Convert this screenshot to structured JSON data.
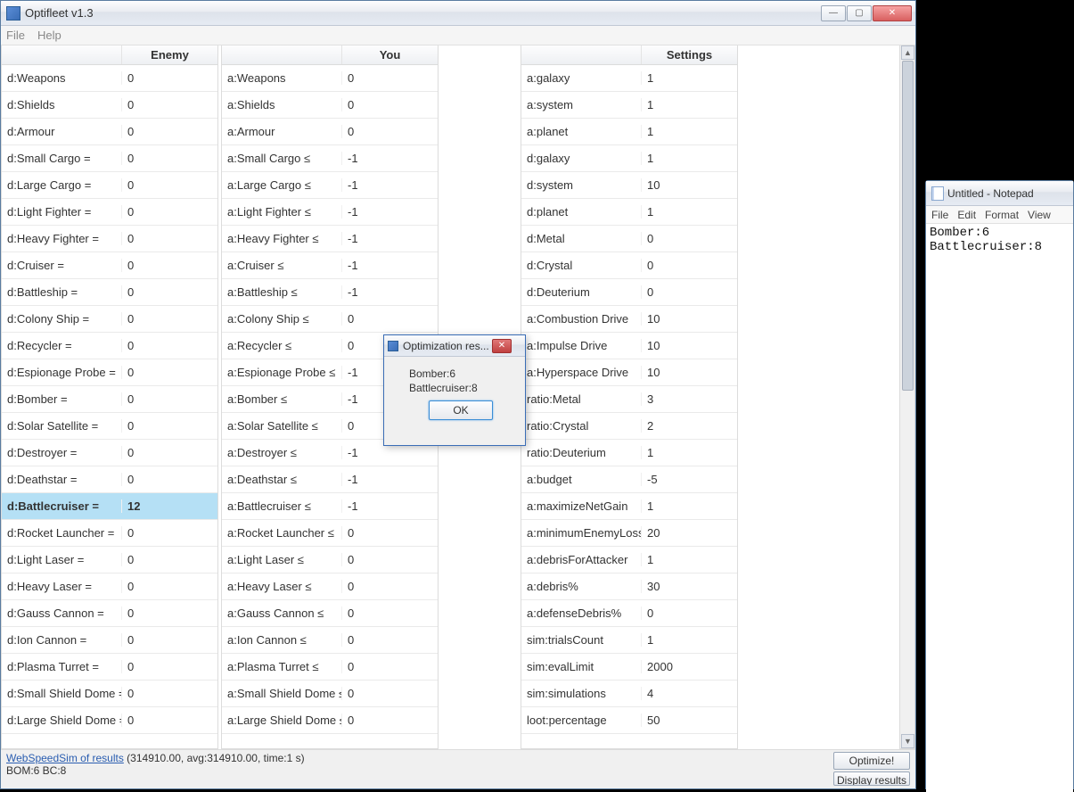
{
  "main": {
    "title": "Optifleet v1.3",
    "menu": {
      "file": "File",
      "help": "Help"
    },
    "headers": {
      "enemy": "Enemy",
      "you": "You",
      "settings": "Settings"
    },
    "enemy_rows": [
      {
        "label": "d:Weapons",
        "value": "0"
      },
      {
        "label": "d:Shields",
        "value": "0"
      },
      {
        "label": "d:Armour",
        "value": "0"
      },
      {
        "label": "d:Small Cargo =",
        "value": "0"
      },
      {
        "label": "d:Large Cargo =",
        "value": "0"
      },
      {
        "label": "d:Light Fighter =",
        "value": "0"
      },
      {
        "label": "d:Heavy Fighter =",
        "value": "0"
      },
      {
        "label": "d:Cruiser =",
        "value": "0"
      },
      {
        "label": "d:Battleship =",
        "value": "0"
      },
      {
        "label": "d:Colony Ship =",
        "value": "0"
      },
      {
        "label": "d:Recycler =",
        "value": "0"
      },
      {
        "label": "d:Espionage Probe =",
        "value": "0"
      },
      {
        "label": "d:Bomber =",
        "value": "0"
      },
      {
        "label": "d:Solar Satellite =",
        "value": "0"
      },
      {
        "label": "d:Destroyer =",
        "value": "0"
      },
      {
        "label": "d:Deathstar =",
        "value": "0"
      },
      {
        "label": "d:Battlecruiser =",
        "value": "12",
        "selected": true
      },
      {
        "label": "d:Rocket Launcher =",
        "value": "0"
      },
      {
        "label": "d:Light Laser =",
        "value": "0"
      },
      {
        "label": "d:Heavy Laser =",
        "value": "0"
      },
      {
        "label": "d:Gauss Cannon =",
        "value": "0"
      },
      {
        "label": "d:Ion Cannon =",
        "value": "0"
      },
      {
        "label": "d:Plasma Turret =",
        "value": "0"
      },
      {
        "label": "d:Small Shield Dome =",
        "value": "0"
      },
      {
        "label": "d:Large Shield Dome =",
        "value": "0"
      }
    ],
    "you_rows": [
      {
        "label": "a:Weapons",
        "value": "0"
      },
      {
        "label": "a:Shields",
        "value": "0"
      },
      {
        "label": "a:Armour",
        "value": "0"
      },
      {
        "label": "a:Small Cargo ≤",
        "value": "-1"
      },
      {
        "label": "a:Large Cargo ≤",
        "value": "-1"
      },
      {
        "label": "a:Light Fighter ≤",
        "value": "-1"
      },
      {
        "label": "a:Heavy Fighter ≤",
        "value": "-1"
      },
      {
        "label": "a:Cruiser ≤",
        "value": "-1"
      },
      {
        "label": "a:Battleship ≤",
        "value": "-1"
      },
      {
        "label": "a:Colony Ship ≤",
        "value": "0"
      },
      {
        "label": "a:Recycler ≤",
        "value": "0"
      },
      {
        "label": "a:Espionage Probe ≤",
        "value": "-1"
      },
      {
        "label": "a:Bomber ≤",
        "value": "-1"
      },
      {
        "label": "a:Solar Satellite ≤",
        "value": "0"
      },
      {
        "label": "a:Destroyer ≤",
        "value": "-1"
      },
      {
        "label": "a:Deathstar ≤",
        "value": "-1"
      },
      {
        "label": "a:Battlecruiser ≤",
        "value": "-1"
      },
      {
        "label": "a:Rocket Launcher ≤",
        "value": "0"
      },
      {
        "label": "a:Light Laser ≤",
        "value": "0"
      },
      {
        "label": "a:Heavy Laser ≤",
        "value": "0"
      },
      {
        "label": "a:Gauss Cannon ≤",
        "value": "0"
      },
      {
        "label": "a:Ion Cannon ≤",
        "value": "0"
      },
      {
        "label": "a:Plasma Turret ≤",
        "value": "0"
      },
      {
        "label": "a:Small Shield Dome ≤",
        "value": "0"
      },
      {
        "label": "a:Large Shield Dome ≤",
        "value": "0"
      }
    ],
    "settings_rows": [
      {
        "label": "a:galaxy",
        "value": "1"
      },
      {
        "label": "a:system",
        "value": "1"
      },
      {
        "label": "a:planet",
        "value": "1"
      },
      {
        "label": "d:galaxy",
        "value": "1"
      },
      {
        "label": "d:system",
        "value": "10"
      },
      {
        "label": "d:planet",
        "value": "1"
      },
      {
        "label": "d:Metal",
        "value": "0"
      },
      {
        "label": "d:Crystal",
        "value": "0"
      },
      {
        "label": "d:Deuterium",
        "value": "0"
      },
      {
        "label": "a:Combustion Drive",
        "value": "10"
      },
      {
        "label": "a:Impulse Drive",
        "value": "10"
      },
      {
        "label": "a:Hyperspace Drive",
        "value": "10"
      },
      {
        "label": "ratio:Metal",
        "value": "3"
      },
      {
        "label": "ratio:Crystal",
        "value": "2"
      },
      {
        "label": "ratio:Deuterium",
        "value": "1"
      },
      {
        "label": "a:budget",
        "value": "-5"
      },
      {
        "label": "a:maximizeNetGain",
        "value": "1"
      },
      {
        "label": "a:minimumEnemyLoss%",
        "value": "20"
      },
      {
        "label": "a:debrisForAttacker",
        "value": "1"
      },
      {
        "label": "a:debris%",
        "value": "30"
      },
      {
        "label": "a:defenseDebris%",
        "value": "0"
      },
      {
        "label": "sim:trialsCount",
        "value": "1"
      },
      {
        "label": "sim:evalLimit",
        "value": "2000"
      },
      {
        "label": "sim:simulations",
        "value": "4"
      },
      {
        "label": "loot:percentage",
        "value": "50"
      }
    ],
    "footer": {
      "link": "WebSpeedSim of results",
      "stats": " (314910.00, avg:314910.00, time:1 s)",
      "line2": "BOM:6 BC:8",
      "optimize": "Optimize!",
      "display": "Display results"
    }
  },
  "dialog": {
    "title": "Optimization res...",
    "line1": "Bomber:6",
    "line2": "Battlecruiser:8",
    "ok": "OK"
  },
  "notepad": {
    "title": "Untitled - Notepad",
    "menu": {
      "file": "File",
      "edit": "Edit",
      "format": "Format",
      "view": "View"
    },
    "content": "Bomber:6\nBattlecruiser:8"
  }
}
